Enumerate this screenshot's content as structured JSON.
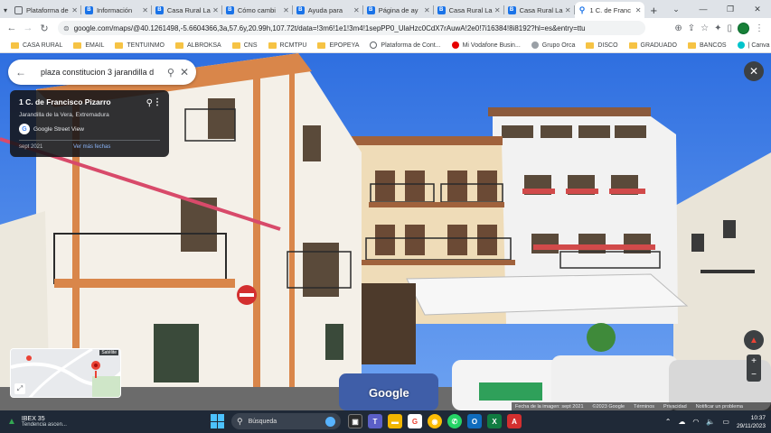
{
  "browser": {
    "tabs": [
      {
        "label": "Plataforma de",
        "favicon": "platform-icon",
        "active": false
      },
      {
        "label": "Información",
        "favicon": "b-icon",
        "active": false
      },
      {
        "label": "Casa Rural La",
        "favicon": "b-icon",
        "active": false
      },
      {
        "label": "Cómo cambi",
        "favicon": "b-icon",
        "active": false
      },
      {
        "label": "Ayuda para",
        "favicon": "b-icon",
        "active": false
      },
      {
        "label": "Página de ay",
        "favicon": "b-icon",
        "active": false
      },
      {
        "label": "Casa Rural La",
        "favicon": "b-icon",
        "active": false
      },
      {
        "label": "Casa Rural La",
        "favicon": "b-icon",
        "active": false
      },
      {
        "label": "1 C. de Franc",
        "favicon": "maps-pin-icon",
        "active": true
      }
    ],
    "url": "google.com/maps/@40.1261498,-5.6604366,3a,57.6y,20.99h,107.72t/data=!3m6!1e1!3m4!1sepPP0_UlaHzc0CdX7rAuwA!2e0!7i16384!8i8192?hl=es&entry=ttu",
    "bookmarks": [
      {
        "label": "CASA RURAL",
        "type": "folder"
      },
      {
        "label": "EMAIL",
        "type": "folder"
      },
      {
        "label": "TENTUINMO",
        "type": "folder"
      },
      {
        "label": "ALBROKSA",
        "type": "folder"
      },
      {
        "label": "CNS",
        "type": "folder"
      },
      {
        "label": "RCMTPU",
        "type": "folder"
      },
      {
        "label": "EPOPEYA",
        "type": "folder"
      },
      {
        "label": "Plataforma de Cont...",
        "type": "link"
      },
      {
        "label": "Mi Vodafone Busin...",
        "type": "link"
      },
      {
        "label": "Grupo Orca",
        "type": "link"
      },
      {
        "label": "DISCO",
        "type": "folder"
      },
      {
        "label": "GRADUADO",
        "type": "folder"
      },
      {
        "label": "BANCOS",
        "type": "folder"
      },
      {
        "label": "| Canva",
        "type": "link"
      }
    ]
  },
  "maps": {
    "search_query": "plaza constitucion 3 jarandilla d",
    "place": {
      "title": "1 C. de Francisco Pizarro",
      "subtitle": "Jarandilla de la Vera, Extremadura",
      "provider": "Google Street View",
      "capture_date": "sept 2021",
      "more_dates": "Ver más fechas"
    },
    "google_logo": "Google",
    "footer": {
      "image_date": "Fecha de la imagen: sept 2021",
      "copyright": "©2023 Google",
      "terms": "Términos",
      "privacy": "Privacidad",
      "report": "Notificar un problema"
    },
    "minimap_tag": "Satélite"
  },
  "taskbar": {
    "ticker_name": "IBEX 35",
    "ticker_trend": "Tendencia ascen...",
    "search_placeholder": "Búsqueda",
    "time": "10:37",
    "date": "29/11/2023"
  },
  "colors": {
    "maps_blue": "#1a73e8",
    "taskbar_bg": "#1f2937",
    "accent_red": "#ea4335"
  }
}
